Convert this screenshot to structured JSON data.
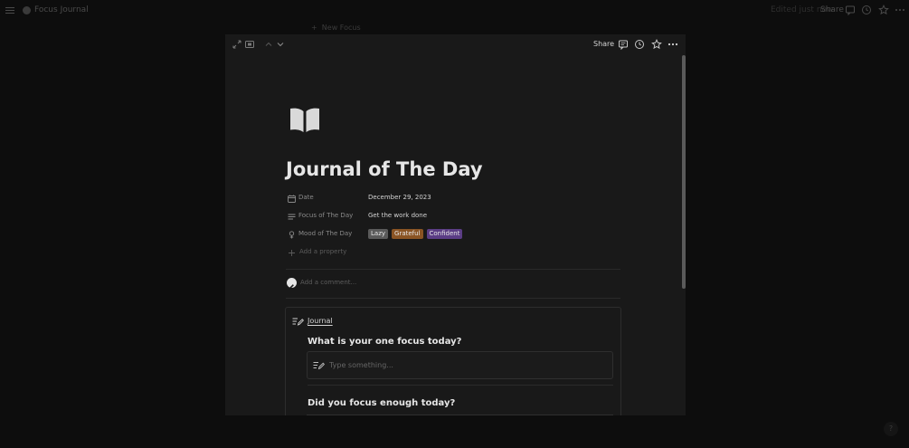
{
  "background": {
    "page_title": "Focus Journal",
    "edited_label": "Edited just now",
    "share_label": "Share",
    "new_focus_label": "New Focus",
    "help_label": "?"
  },
  "modal": {
    "share_label": "Share"
  },
  "page": {
    "icon": "book-icon",
    "title": "Journal of The Day",
    "properties": {
      "date": {
        "label": "Date",
        "value": "December 29, 2023",
        "icon": "calendar-icon"
      },
      "focus": {
        "label": "Focus of The Day",
        "value": "Get the work done",
        "icon": "text-lines-icon"
      },
      "mood": {
        "label": "Mood of The Day",
        "icon": "person-icon",
        "tags": [
          {
            "label": "Lazy",
            "color": "#5a5a5a"
          },
          {
            "label": "Grateful",
            "color": "#8a5424"
          },
          {
            "label": "Confident",
            "color": "#5b3d85"
          }
        ]
      }
    },
    "add_property_label": "Add a property",
    "comment_placeholder": "Add a comment..."
  },
  "journal": {
    "label": "Journal",
    "questions": [
      {
        "text": "What is your one focus today?",
        "placeholder": "Type something..."
      },
      {
        "text": "Did you focus enough today?"
      }
    ]
  }
}
